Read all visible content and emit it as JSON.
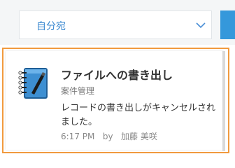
{
  "filter": {
    "selected": "自分宛"
  },
  "notification": {
    "icon": "notebook-icon",
    "title": "ファイルへの書き出し",
    "category": "案件管理",
    "message": "レコードの書き出しがキャンセルされました。",
    "time": "6:17 PM",
    "by_label": "by",
    "author": "加藤 美咲"
  },
  "colors": {
    "accent": "#3598db",
    "highlight_border": "#f19a3e",
    "link_text": "#3a88d0"
  }
}
